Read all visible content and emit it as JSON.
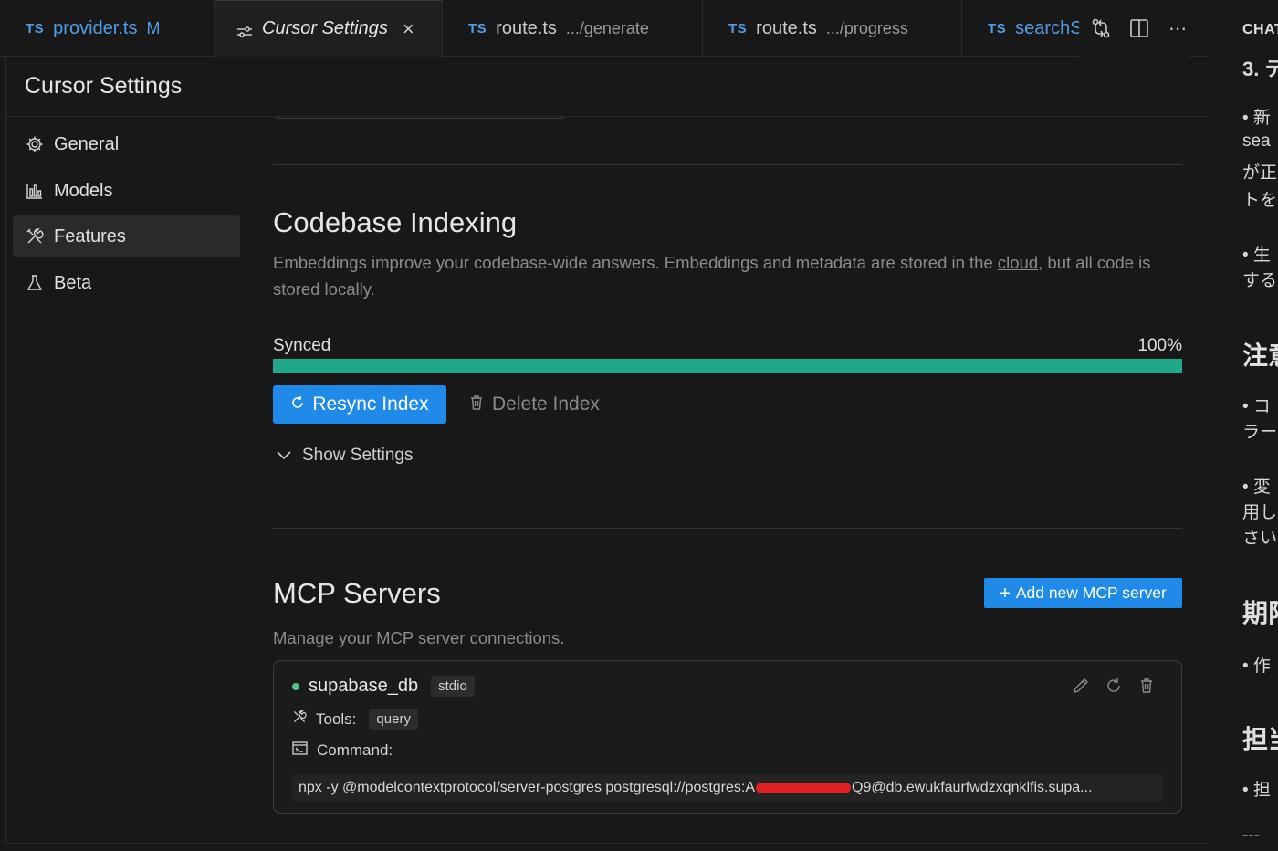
{
  "tabs": [
    {
      "lang": "TS",
      "name": "provider.ts",
      "flag": "M",
      "desc": ""
    },
    {
      "lang": "",
      "name": "Cursor Settings",
      "flag": "",
      "desc": ""
    },
    {
      "lang": "TS",
      "name": "route.ts",
      "flag": "",
      "desc": ".../generate"
    },
    {
      "lang": "TS",
      "name": "route.ts",
      "flag": "",
      "desc": ".../progress"
    },
    {
      "lang": "TS",
      "name": "searchS",
      "flag": "",
      "desc": ""
    }
  ],
  "tab_actions": [
    "git-compare-icon",
    "split-editor-icon",
    "more-icon"
  ],
  "settings_title": "Cursor Settings",
  "nav": [
    {
      "label": "General",
      "icon": "gear-icon"
    },
    {
      "label": "Models",
      "icon": "bar-chart-icon"
    },
    {
      "label": "Features",
      "icon": "tools-icon",
      "active": true
    },
    {
      "label": "Beta",
      "icon": "flask-icon"
    }
  ],
  "indexing": {
    "title": "Codebase Indexing",
    "desc_before": "Embeddings improve your codebase-wide answers. Embeddings and metadata are stored in the ",
    "desc_link": "cloud",
    "desc_after": ", but all code is stored locally.",
    "status": "Synced",
    "percent_label": "100%",
    "progress": 1.0,
    "resync_label": "Resync Index",
    "delete_label": "Delete Index",
    "show_settings_label": "Show Settings"
  },
  "mcp": {
    "title": "MCP Servers",
    "desc": "Manage your MCP server connections.",
    "add_label": "Add new MCP server",
    "server": {
      "name": "supabase_db",
      "transport": "stdio",
      "tools_label": "Tools:",
      "tool": "query",
      "command_label": "Command:",
      "command_prefix": "npx -y @modelcontextprotocol/server-postgres postgresql://postgres:A",
      "command_suffix": "Q9@db.ewukfaurfwdzxqnklfis.supa..."
    }
  },
  "chat": {
    "header": "CHAT",
    "lines": [
      "3. テ",
      "• 新",
      "sea",
      "が正",
      "トを",
      "• 生",
      "する",
      "注意",
      "• コ",
      "ラー",
      "• 変",
      "用し",
      "さい",
      "期限",
      "• 作",
      "担当",
      "• 担",
      "---"
    ]
  },
  "colors": {
    "accent": "#1f8ae8",
    "progress": "#1fa98a",
    "ts_badge": "#4f9fe8",
    "status_dot": "#4fc38b",
    "redaction": "#e02020"
  }
}
